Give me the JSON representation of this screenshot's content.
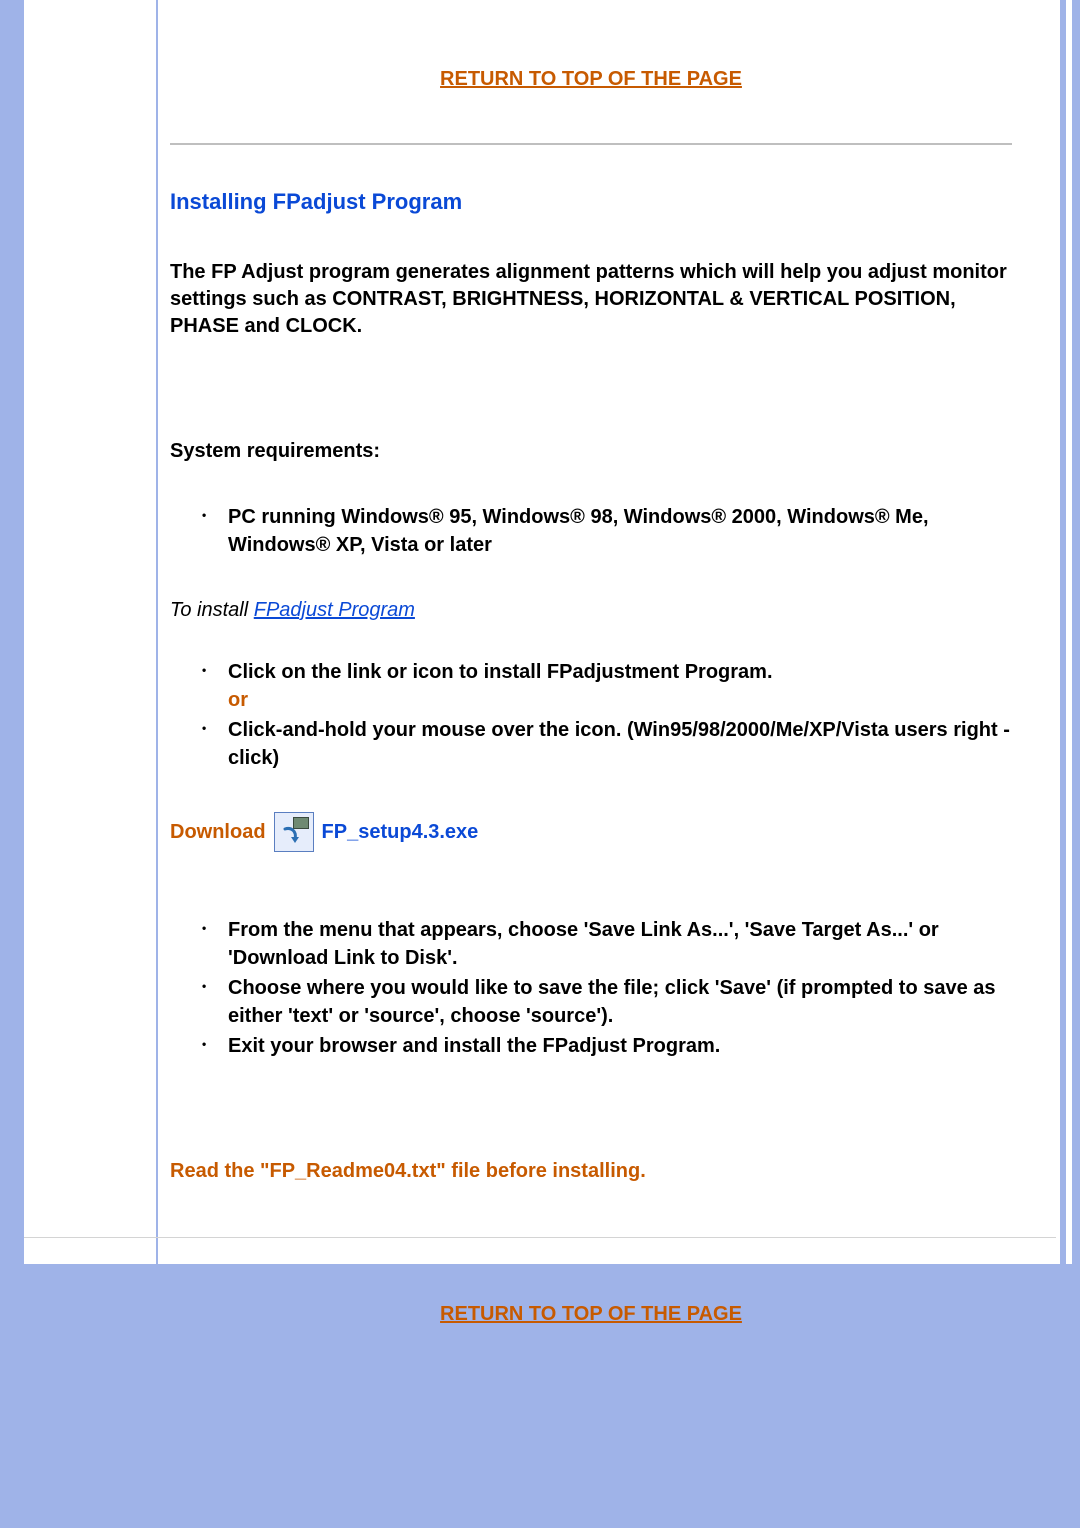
{
  "links": {
    "return_top": "RETURN TO TOP OF THE PAGE",
    "return_bottom": "RETURN TO TOP OF THE PAGE"
  },
  "heading": "Installing FPadjust Program",
  "intro": "The FP Adjust program generates alignment patterns which will help you adjust monitor settings such as CONTRAST, BRIGHTNESS, HORIZONTAL & VERTICAL POSITION, PHASE and CLOCK.",
  "sysreq_heading": "System requirements:",
  "sysreq_items": [
    "PC running Windows® 95, Windows® 98, Windows® 2000, Windows® Me, Windows® XP, Vista or later"
  ],
  "to_install_prefix": "To install ",
  "to_install_link": "FPadjust Program",
  "install_top_items": {
    "line1": "Click on the link or icon to install FPadjustment Program.",
    "or": "or",
    "line2": "Click-and-hold your mouse over the icon. (Win95/98/2000/Me/XP/Vista users right -click)"
  },
  "download": {
    "label": "Download",
    "filename": "FP_setup4.3.exe"
  },
  "post_download_items": [
    "From the menu that appears, choose 'Save Link As...', 'Save Target As...' or 'Download Link to Disk'.",
    "Choose where you would like to save the file; click 'Save' (if prompted to save as either 'text' or 'source', choose 'source').",
    "Exit your browser and install the FPadjust Program."
  ],
  "readme_note": "Read the \"FP_Readme04.txt\" file before installing."
}
